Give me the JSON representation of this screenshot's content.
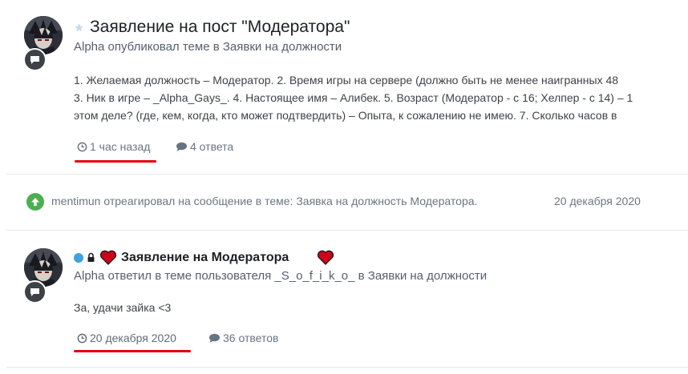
{
  "entries": [
    {
      "title": "Заявление на пост \"Модератора\"",
      "meta": "Alpha опубликовал теме в Заявки на должности",
      "snippet_lines": [
        "1. Желаемая должность – Модератор. 2. Время игры на сервере (должно быть не менее наигранных 48",
        "3. Ник в игре – _Alpha_Gays_. 4. Настоящее имя – Алибек. 5. Возраст (Модератор - с 16; Хелпер - с 14) – 1",
        "этом деле? (где, кем, когда, кто может подтвердить) – Опыта, к сожалению не имею. 7. Сколько часов в"
      ],
      "time": "1 час назад",
      "replies": "4 ответа"
    },
    {
      "title": "Заявление на Модератора",
      "meta": "Alpha ответил в теме пользователя _S_o_f_i_k_o_ в Заявки на должности",
      "snippet_lines": [
        "За, удачи зайка <3"
      ],
      "time": "20 декабря 2020",
      "replies": "36 ответов"
    }
  ],
  "activity": {
    "text": "mentimun отреагировал на сообщение в теме: Заявка на должность Модератора.",
    "date": "20 декабря 2020"
  },
  "colors": {
    "accent_underline": "#e3000f",
    "reaction_green": "#4caf50",
    "heart_red": "#d0021b",
    "online_dot": "#3ea3dc"
  }
}
